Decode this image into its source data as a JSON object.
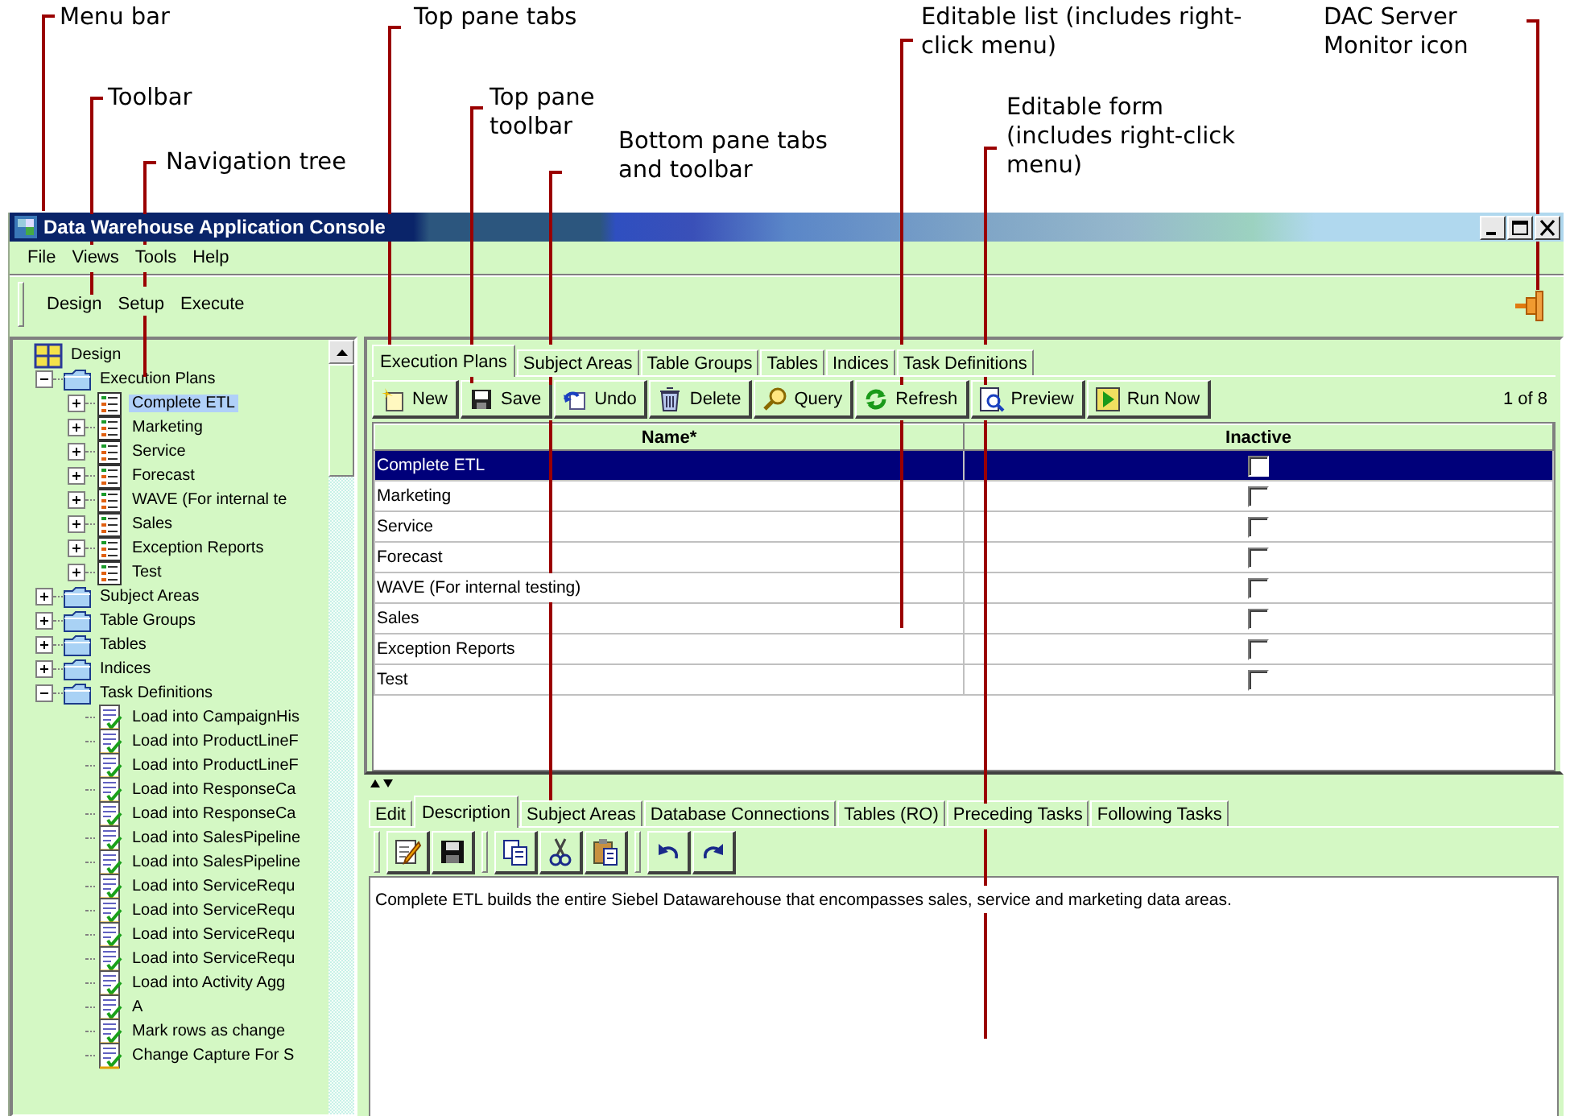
{
  "callouts": [
    "Menu bar",
    "Toolbar",
    "Navigation tree",
    "Top pane tabs",
    "Top pane toolbar",
    "Bottom pane tabs and toolbar",
    "Editable list (includes right-click menu)",
    "Editable form (includes right-click menu)",
    "DAC Server Monitor icon"
  ],
  "window": {
    "title": "Data Warehouse Application Console"
  },
  "menu": [
    "File",
    "Views",
    "Tools",
    "Help"
  ],
  "toolbar": [
    "Design",
    "Setup",
    "Execute"
  ],
  "tree": [
    {
      "label": "Design",
      "kind": "root",
      "selected": false,
      "children": [
        {
          "label": "Execution Plans",
          "kind": "folder",
          "expanded": true,
          "selected": false,
          "children": [
            {
              "label": "Complete ETL",
              "kind": "plan",
              "expanded": false,
              "selected": true
            },
            {
              "label": "Marketing",
              "kind": "plan",
              "expanded": false,
              "selected": false
            },
            {
              "label": "Service",
              "kind": "plan",
              "expanded": false,
              "selected": false
            },
            {
              "label": "Forecast",
              "kind": "plan",
              "expanded": false,
              "selected": false
            },
            {
              "label": "WAVE (For internal te",
              "kind": "plan",
              "expanded": false,
              "selected": false
            },
            {
              "label": "Sales",
              "kind": "plan",
              "expanded": false,
              "selected": false
            },
            {
              "label": "Exception Reports",
              "kind": "plan",
              "expanded": false,
              "selected": false
            },
            {
              "label": "Test",
              "kind": "plan",
              "expanded": false,
              "selected": false
            }
          ]
        },
        {
          "label": "Subject Areas",
          "kind": "folder",
          "expanded": false,
          "selected": false
        },
        {
          "label": "Table Groups",
          "kind": "folder",
          "expanded": false,
          "selected": false
        },
        {
          "label": "Tables",
          "kind": "folder",
          "expanded": false,
          "selected": false
        },
        {
          "label": "Indices",
          "kind": "folder",
          "expanded": false,
          "selected": false
        },
        {
          "label": "Task Definitions",
          "kind": "folder",
          "expanded": true,
          "selected": false,
          "children": [
            {
              "label": "Load into CampaignHis",
              "kind": "task",
              "selected": false
            },
            {
              "label": "Load into ProductLineF",
              "kind": "task",
              "selected": false
            },
            {
              "label": "Load into ProductLineF",
              "kind": "task",
              "selected": false
            },
            {
              "label": "Load into ResponseCa",
              "kind": "task",
              "selected": false
            },
            {
              "label": "Load into ResponseCa",
              "kind": "task",
              "selected": false
            },
            {
              "label": "Load into SalesPipeline",
              "kind": "task",
              "selected": false
            },
            {
              "label": "Load into SalesPipeline",
              "kind": "task",
              "selected": false
            },
            {
              "label": "Load into ServiceRequ",
              "kind": "task",
              "selected": false
            },
            {
              "label": "Load into ServiceRequ",
              "kind": "task",
              "selected": false
            },
            {
              "label": "Load into ServiceRequ",
              "kind": "task",
              "selected": false
            },
            {
              "label": "Load into ServiceRequ",
              "kind": "task",
              "selected": false
            },
            {
              "label": "Load into Activity Agg",
              "kind": "task",
              "selected": false
            },
            {
              "label": "A",
              "kind": "task",
              "selected": false
            },
            {
              "label": "Mark rows as change",
              "kind": "task",
              "selected": false
            },
            {
              "label": "Change Capture For S",
              "kind": "task",
              "selected": false
            }
          ]
        }
      ]
    }
  ],
  "top_tabs": [
    {
      "label": "Execution Plans",
      "selected": true
    },
    {
      "label": "Subject Areas",
      "selected": false
    },
    {
      "label": "Table Groups",
      "selected": false
    },
    {
      "label": "Tables",
      "selected": false
    },
    {
      "label": "Indices",
      "selected": false
    },
    {
      "label": "Task Definitions",
      "selected": false
    }
  ],
  "top_toolbar": {
    "buttons": [
      {
        "label": "New",
        "kind": "new"
      },
      {
        "label": "Save",
        "kind": "save"
      },
      {
        "label": "Undo",
        "kind": "undo"
      },
      {
        "label": "Delete",
        "kind": "delete"
      },
      {
        "label": "Query",
        "kind": "query"
      },
      {
        "label": "Refresh",
        "kind": "refresh"
      },
      {
        "label": "Preview",
        "kind": "preview"
      },
      {
        "label": "Run Now",
        "kind": "run"
      }
    ],
    "record_count": "1 of 8"
  },
  "table": {
    "columns": [
      "Name*",
      "Inactive"
    ],
    "rows": [
      {
        "name": "Complete ETL",
        "inactive": false,
        "selected": true
      },
      {
        "name": "Marketing",
        "inactive": false,
        "selected": false
      },
      {
        "name": "Service",
        "inactive": false,
        "selected": false
      },
      {
        "name": "Forecast",
        "inactive": false,
        "selected": false
      },
      {
        "name": "WAVE (For internal testing)",
        "inactive": false,
        "selected": false
      },
      {
        "name": "Sales",
        "inactive": false,
        "selected": false
      },
      {
        "name": "Exception Reports",
        "inactive": false,
        "selected": false
      },
      {
        "name": "Test",
        "inactive": false,
        "selected": false
      }
    ]
  },
  "bottom_tabs": [
    {
      "label": "Edit",
      "selected": false
    },
    {
      "label": "Description",
      "selected": true
    },
    {
      "label": "Subject Areas",
      "selected": false
    },
    {
      "label": "Database Connections",
      "selected": false
    },
    {
      "label": "Tables (RO)",
      "selected": false
    },
    {
      "label": "Preceding Tasks",
      "selected": false
    },
    {
      "label": "Following Tasks",
      "selected": false
    }
  ],
  "bottom_toolbar": [
    {
      "kind": "edit"
    },
    {
      "kind": "save"
    },
    {
      "kind": "copy"
    },
    {
      "kind": "cut"
    },
    {
      "kind": "paste"
    },
    {
      "kind": "undo"
    },
    {
      "kind": "redo"
    }
  ],
  "description": "Complete ETL builds the entire Siebel Datawarehouse that encompasses sales, service and marketing data areas."
}
